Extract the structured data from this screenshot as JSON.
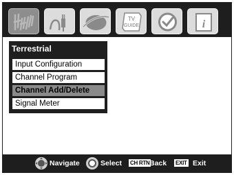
{
  "top_icons": [
    {
      "name": "antenna-icon",
      "active": true
    },
    {
      "name": "plug-icon",
      "active": false
    },
    {
      "name": "planet-icon",
      "active": false
    },
    {
      "name": "tv-guide-icon",
      "active": false,
      "text_line1": "TV",
      "text_line2": "GUIDE"
    },
    {
      "name": "clock-check-icon",
      "active": false
    },
    {
      "name": "info-icon",
      "active": false
    }
  ],
  "menu": {
    "title": "Terrestrial",
    "items": [
      {
        "label": "Input Configuration",
        "selected": false
      },
      {
        "label": "Channel Program",
        "selected": false
      },
      {
        "label": "Channel Add/Delete",
        "selected": true
      },
      {
        "label": "Signal Meter",
        "selected": false
      }
    ]
  },
  "footer": {
    "navigate_label": "Navigate",
    "select_label": "Select",
    "back_key": "CH RTN",
    "back_label": "Back",
    "exit_key": "EXIT",
    "exit_label": "Exit"
  },
  "colors": {
    "bar": "#1e1e1e",
    "highlight": "#8a8a8a",
    "tile": "#dcdcdc"
  }
}
